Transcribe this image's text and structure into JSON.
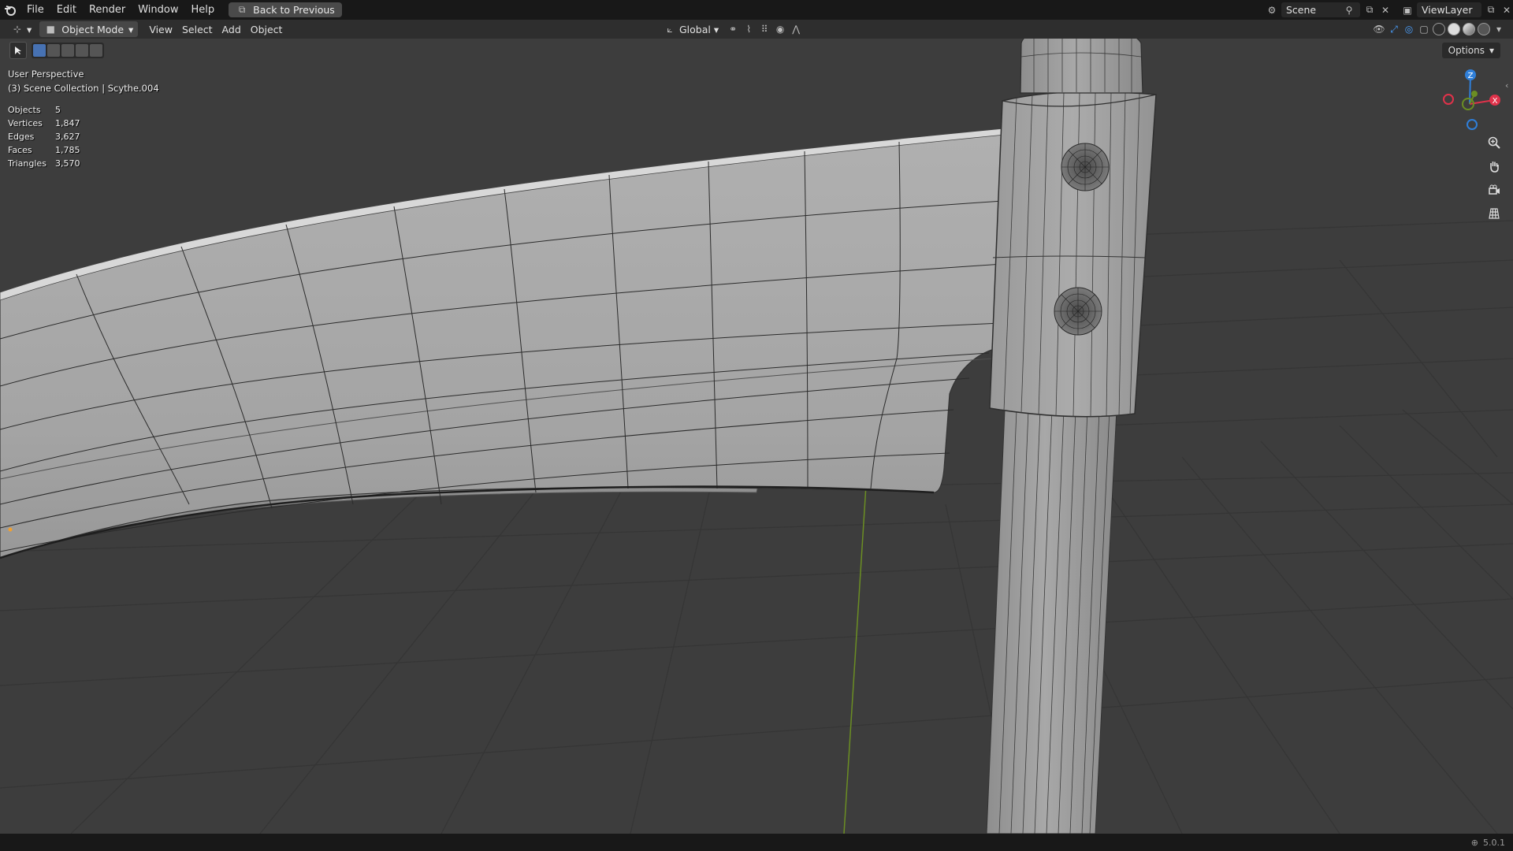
{
  "menubar": {
    "items": [
      "File",
      "Edit",
      "Render",
      "Window",
      "Help"
    ],
    "back_button": "Back to Previous",
    "scene": "Scene",
    "view_layer": "ViewLayer"
  },
  "viewport_header": {
    "mode": "Object Mode",
    "menus": [
      "View",
      "Select",
      "Add",
      "Object"
    ],
    "transform_orientation": "Global",
    "options": "Options"
  },
  "overlay": {
    "perspective": "User Perspective",
    "collection": "(3) Scene Collection | Scythe.004"
  },
  "stats": [
    {
      "label": "Objects",
      "value": "5"
    },
    {
      "label": "Vertices",
      "value": "1,847"
    },
    {
      "label": "Edges",
      "value": "3,627"
    },
    {
      "label": "Faces",
      "value": "1,785"
    },
    {
      "label": "Triangles",
      "value": "3,570"
    }
  ],
  "gizmo": {
    "z": "Z",
    "x": "X"
  },
  "status": {
    "version": "5.0.1"
  },
  "colors": {
    "background": "#3d3d3d",
    "mesh": "#a3a3a3",
    "axis_y": "#6b8e23",
    "axis_x": "#e0324a",
    "axis_z": "#2f7fd9"
  }
}
